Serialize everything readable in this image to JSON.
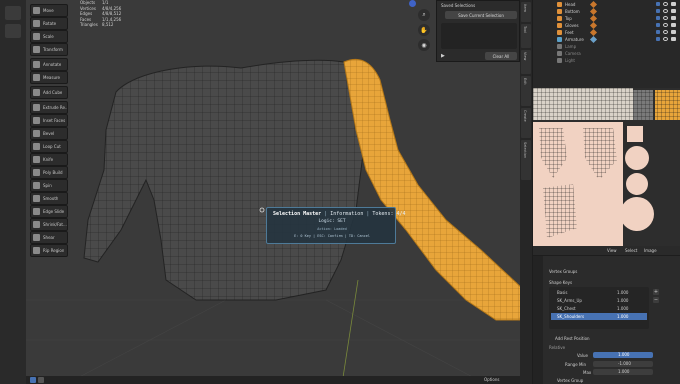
{
  "toolbar": {
    "items": [
      {
        "label": "Move"
      },
      {
        "label": "Rotate"
      },
      {
        "label": "Scale"
      },
      {
        "label": "Transform"
      },
      {
        "label": "Annotate"
      },
      {
        "label": "Measure"
      },
      {
        "label": "Add Cube"
      },
      {
        "label": "Extrude Re..."
      },
      {
        "label": "Inset Faces"
      },
      {
        "label": "Bevel"
      },
      {
        "label": "Loop Cut"
      },
      {
        "label": "Knife"
      },
      {
        "label": "Poly Build"
      },
      {
        "label": "Spin"
      },
      {
        "label": "Smooth"
      },
      {
        "label": "Edge Slide"
      },
      {
        "label": "Shrink/Fat..."
      },
      {
        "label": "Shear"
      },
      {
        "label": "Rip Region"
      }
    ]
  },
  "stats": {
    "rows": [
      {
        "k": "Objects",
        "v": "1/1"
      },
      {
        "k": "Vertices",
        "v": "4/8/4,256"
      },
      {
        "k": "Edges",
        "v": "4/8/8,512"
      },
      {
        "k": "Faces",
        "v": "1/1,4,256"
      },
      {
        "k": "Triangles",
        "v": "8,512"
      }
    ]
  },
  "saved_selections": {
    "header": "Saved Selections",
    "save_button": "Save Current Selection",
    "clear_button": "Clear All"
  },
  "tooltip": {
    "title": "Selection Master",
    "info1": "Information",
    "info2": "Tokens: 4/4",
    "logic": "Logic: SET",
    "status": "Action: Loaded",
    "hint": "E: 0 Key  |  ESC: Confirm  |  TD: Cancel"
  },
  "outliner": {
    "rows": [
      {
        "name": "Head"
      },
      {
        "name": "Bottom"
      },
      {
        "name": "Top"
      },
      {
        "name": "Gloves"
      },
      {
        "name": "Feet"
      },
      {
        "name": "Armature"
      },
      {
        "name": "Lamp"
      },
      {
        "name": "Camera"
      },
      {
        "name": "Light"
      }
    ]
  },
  "uv_header": {
    "view": "View",
    "select": "Select",
    "image": "Image"
  },
  "props": {
    "vertex_groups": "Vertex Groups",
    "shape_keys": "Shape Keys",
    "keys": [
      {
        "name": "Basis",
        "value": "1.000"
      },
      {
        "name": "SK_Arms_Up",
        "value": "1.000"
      },
      {
        "name": "SK_Chest",
        "value": "1.000"
      },
      {
        "name": "SK_Shoulders",
        "value": "1.000"
      }
    ],
    "add_rest": "Add Rest Position",
    "relative": "Relative",
    "value_label": "Value",
    "value": "1.000",
    "range_min_label": "Range Min",
    "range_min": "-1.000",
    "max_label": "Max",
    "max": "1.000",
    "vertex_group_label": "Vertex Group"
  },
  "bottombar": {
    "options": "Options"
  },
  "colors": {
    "accent": "#e8a53a",
    "selection": "#4772b3",
    "tooltip_border": "#4e7a98"
  }
}
